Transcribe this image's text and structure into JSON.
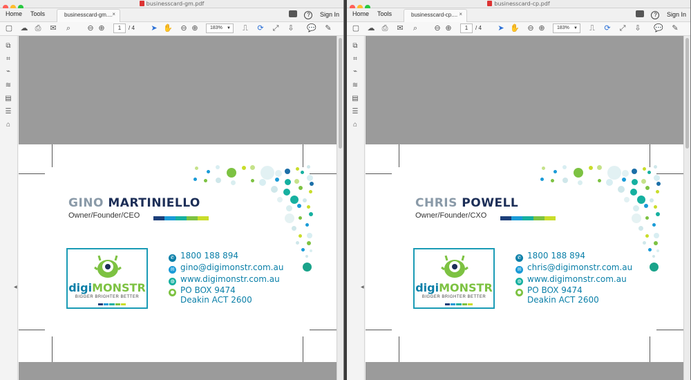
{
  "windows": [
    {
      "side": "left",
      "doc_title": "businesscard-gm.pdf",
      "tab_label": "businesscard-gm....",
      "menu": {
        "home": "Home",
        "tools": "Tools",
        "sign_in": "Sign In"
      },
      "toolbar": {
        "page_current": "1",
        "page_total": "/ 4",
        "zoom": "183%"
      },
      "card": {
        "first_name": "GINO",
        "last_name": "MARTINIELLO",
        "role": "Owner/Founder/CEO",
        "logo_digi": "digi",
        "logo_monstr": "MONSTR",
        "tagline": "BIGGER BRIGHTER BETTER",
        "phone": "1800  188 894",
        "email": "gino@digimonstr.com.au",
        "web": "www.digimonstr.com.au",
        "address1": "PO BOX 9474",
        "address2": "Deakin ACT 2600"
      }
    },
    {
      "side": "right",
      "doc_title": "businesscard-cp.pdf",
      "tab_label": "businesscard-cp....",
      "menu": {
        "home": "Home",
        "tools": "Tools",
        "sign_in": "Sign In"
      },
      "toolbar": {
        "page_current": "1",
        "page_total": "/ 4",
        "zoom": "183%"
      },
      "card": {
        "first_name": "CHRIS",
        "last_name": "POWELL",
        "role": "Owner/Founder/CXO",
        "logo_digi": "digi",
        "logo_monstr": "MONSTR",
        "tagline": "BIGGER BRIGHTER BETTER",
        "phone": "1800  188 894",
        "email": "chris@digimonstr.com.au",
        "web": "www.digimonstr.com.au",
        "address1": "PO BOX 9474",
        "address2": "Deakin ACT 2600"
      }
    }
  ],
  "colors": {
    "first_name": "#8a9aa8",
    "last_name": "#1c2e57",
    "brand_teal": "#0a7fa8",
    "brand_green": "#7dc242",
    "stripe": [
      "#1c3f7a",
      "#1a9bd7",
      "#16b0a0",
      "#7dc242",
      "#c9dd2a"
    ],
    "accent_dot": "#1aa38a"
  },
  "icons": {
    "toolbar": [
      "save-icon",
      "upload-icon",
      "print-icon",
      "email-icon",
      "search-icon",
      "prev-page-icon",
      "next-page-icon",
      "select-cursor-icon",
      "hand-icon",
      "zoom-out-icon",
      "zoom-in-icon",
      "fit-page-icon",
      "rotate-icon",
      "fullscreen-icon",
      "scroll-mode-icon",
      "comment-icon",
      "sign-icon"
    ],
    "sidebar": [
      "pages-icon",
      "bookmark-icon",
      "attachment-icon",
      "layers-icon",
      "document-icon",
      "form-icon",
      "tag-icon"
    ]
  }
}
